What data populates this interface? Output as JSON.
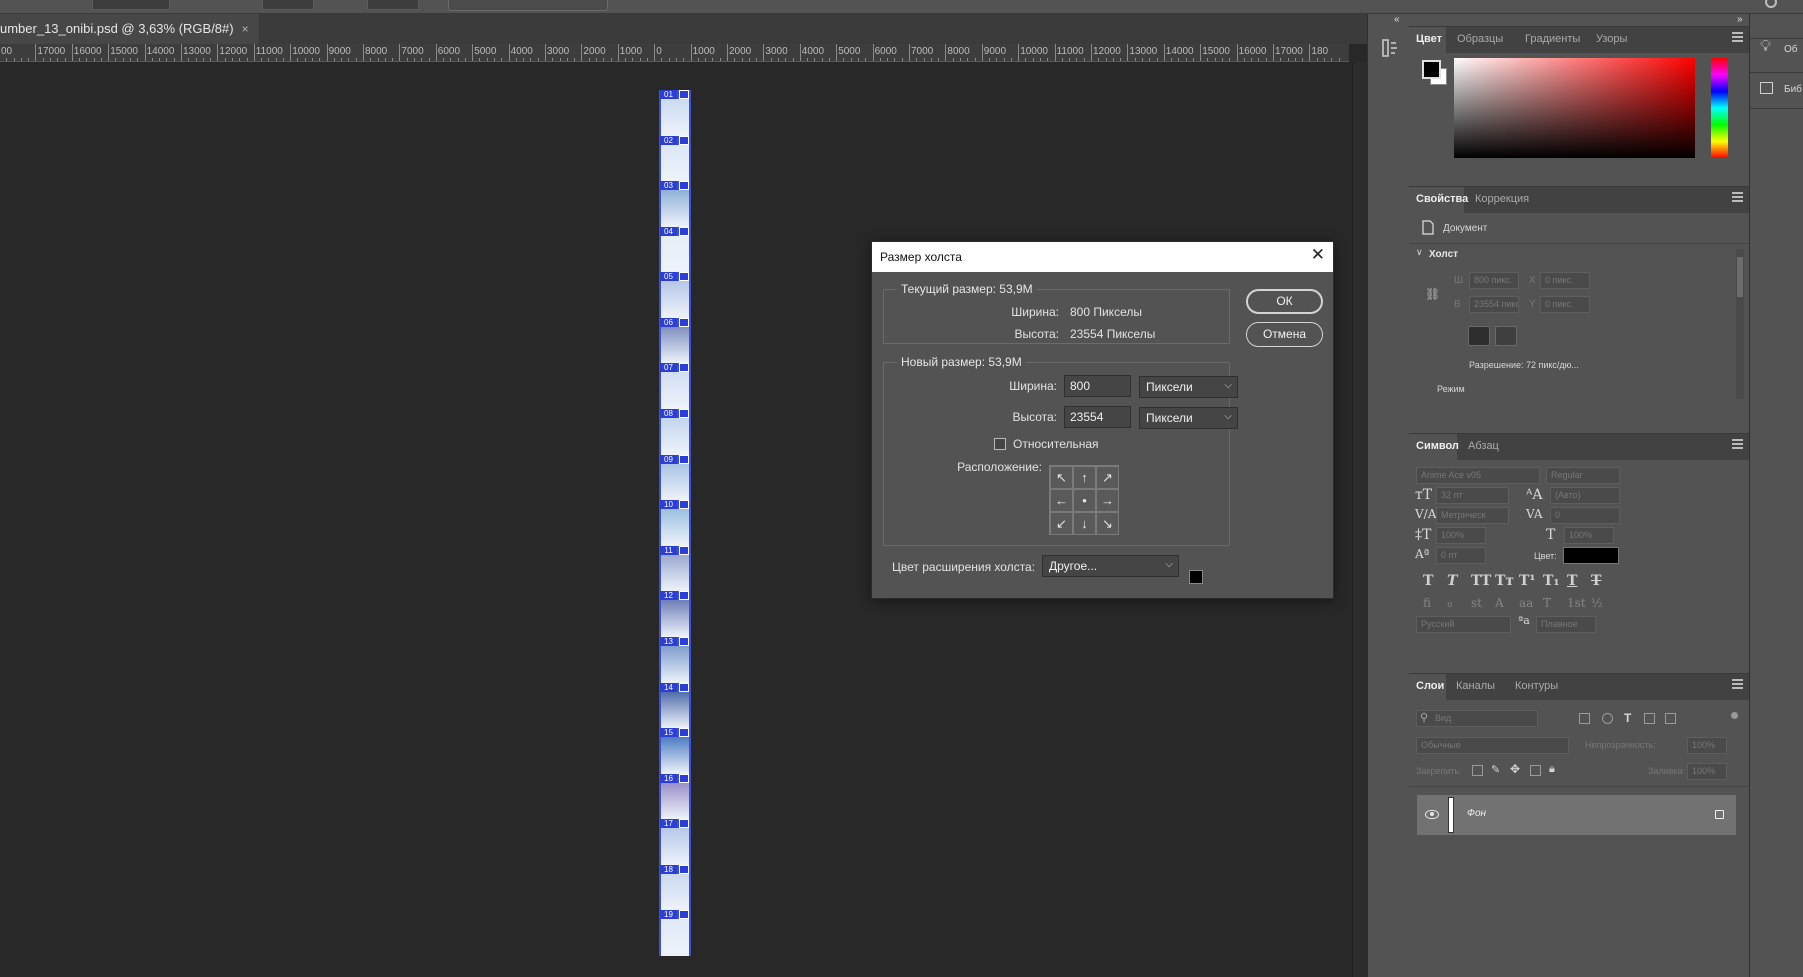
{
  "document": {
    "tab_title": "umber_13_onibi.psd @ 3,63% (RGB/8#)",
    "tab_close": "×"
  },
  "ruler": {
    "labels": [
      "00",
      "17000",
      "16000",
      "15000",
      "14000",
      "13000",
      "12000",
      "11000",
      "10000",
      "9000",
      "8000",
      "7000",
      "6000",
      "5000",
      "4000",
      "3000",
      "2000",
      "1000",
      "0",
      "1000",
      "2000",
      "3000",
      "4000",
      "5000",
      "6000",
      "7000",
      "8000",
      "9000",
      "10000",
      "11000",
      "12000",
      "13000",
      "14000",
      "15000",
      "16000",
      "17000",
      "180"
    ]
  },
  "canvas": {
    "strip_labels": [
      "01",
      "02",
      "03",
      "04",
      "05",
      "06",
      "07",
      "08",
      "09",
      "10",
      "11",
      "12",
      "13",
      "14",
      "15",
      "16",
      "17",
      "18",
      "19"
    ]
  },
  "tool_column": {
    "collapse_left": "«",
    "collapse_right": "»",
    "history_icon": "history-brush-icon"
  },
  "color_panel": {
    "tabs": [
      "Цвет",
      "Образцы",
      "Градиенты",
      "Узоры"
    ],
    "foreground": "#000000",
    "background": "#ffffff",
    "picker_hue": "#ff0000"
  },
  "properties_panel": {
    "tabs": [
      "Свойства",
      "Коррекция"
    ],
    "doc_label": "Документ",
    "canvas_section": "Холст",
    "w_label": "Ш",
    "w_value": "800 пикс.",
    "h_label": "В",
    "h_value": "23554 пикс",
    "x_label": "X",
    "x_value": "0 пикс.",
    "y_label": "Y",
    "y_value": "0 пикс.",
    "resolution": "Разрешение: 72 пикс/дю...",
    "mode_label": "Режим"
  },
  "character_panel": {
    "tabs": [
      "Символ",
      "Абзац"
    ],
    "font_family": "Anime Ace v05",
    "font_style": "Regular",
    "font_size": "32 пт",
    "leading": "(Авто)",
    "kerning": "Метрическ",
    "tracking": "0",
    "vertical_scale": "100%",
    "horizontal_scale": "100%",
    "baseline": "0 пт",
    "color_label": "Цвет:",
    "language": "Русский",
    "antialias": "Плавное",
    "type_buttons": [
      "T",
      "T",
      "TT",
      "Tт",
      "T¹",
      "T₁",
      "T",
      "T"
    ],
    "opentype_buttons": [
      "ﬁ",
      "ℴ",
      "st",
      "A",
      "aa",
      "T",
      "1st",
      "½"
    ]
  },
  "layers_panel": {
    "tabs": [
      "Слои",
      "Каналы",
      "Контуры"
    ],
    "filter_placeholder": "Вид",
    "blend_mode": "Обычные",
    "opacity_label": "Непрозрачность:",
    "opacity_value": "100%",
    "lock_label": "Закрепить:",
    "fill_label": "Заливка:",
    "fill_value": "100%",
    "layers": [
      {
        "name": "Фон",
        "visible": true,
        "locked": true
      }
    ]
  },
  "far_panel": {
    "items": [
      "Об",
      "Биб"
    ]
  },
  "dialog": {
    "title": "Размер холста",
    "current_size_label": "Текущий размер:  53,9M",
    "current_width_label": "Ширина:",
    "current_width_value": "800 Пикселы",
    "current_height_label": "Высота:",
    "current_height_value": "23554 Пикселы",
    "new_size_label": "Новый размер: 53,9M",
    "width_label": "Ширина:",
    "width_value": "800",
    "width_unit": "Пиксели",
    "height_label": "Высота:",
    "height_value": "23554",
    "height_unit": "Пиксели",
    "relative_label": "Относительная",
    "relative_checked": false,
    "anchor_label": "Расположение:",
    "anchor_arrows": [
      "↖",
      "↑",
      "↗",
      "←",
      "•",
      "→",
      "↙",
      "↓",
      "↘"
    ],
    "extension_color_label": "Цвет расширения холста:",
    "extension_color_value": "Другое...",
    "extension_color": "#000000",
    "ok_label": "ОК",
    "cancel_label": "Отмена",
    "close_glyph": "✕"
  }
}
